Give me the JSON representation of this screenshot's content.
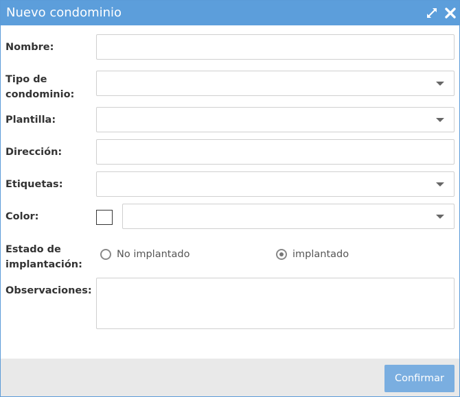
{
  "dialog": {
    "title": "Nuevo condominio",
    "icons": [
      "expand-icon",
      "close-icon"
    ],
    "colors": {
      "titlebar": "#5c9edb",
      "button": "#7aaee0",
      "footer": "#e9e9e9"
    }
  },
  "form": {
    "nombre_label": "Nombre:",
    "tipo_label_line1": "Tipo de",
    "tipo_label_line2": "condominio:",
    "plantilla_label": "Plantilla:",
    "direccion_label": "Dirección:",
    "etiquetas_label": "Etiquetas:",
    "color_label": "Color:",
    "estado_label_line1": "Estado de",
    "estado_label_line2": "implantación:",
    "estado_options": [
      "No implantado",
      "implantado"
    ],
    "estado_selected": "implantado",
    "observaciones_label": "Observaciones:"
  },
  "footer": {
    "confirm_label": "Confirmar"
  }
}
